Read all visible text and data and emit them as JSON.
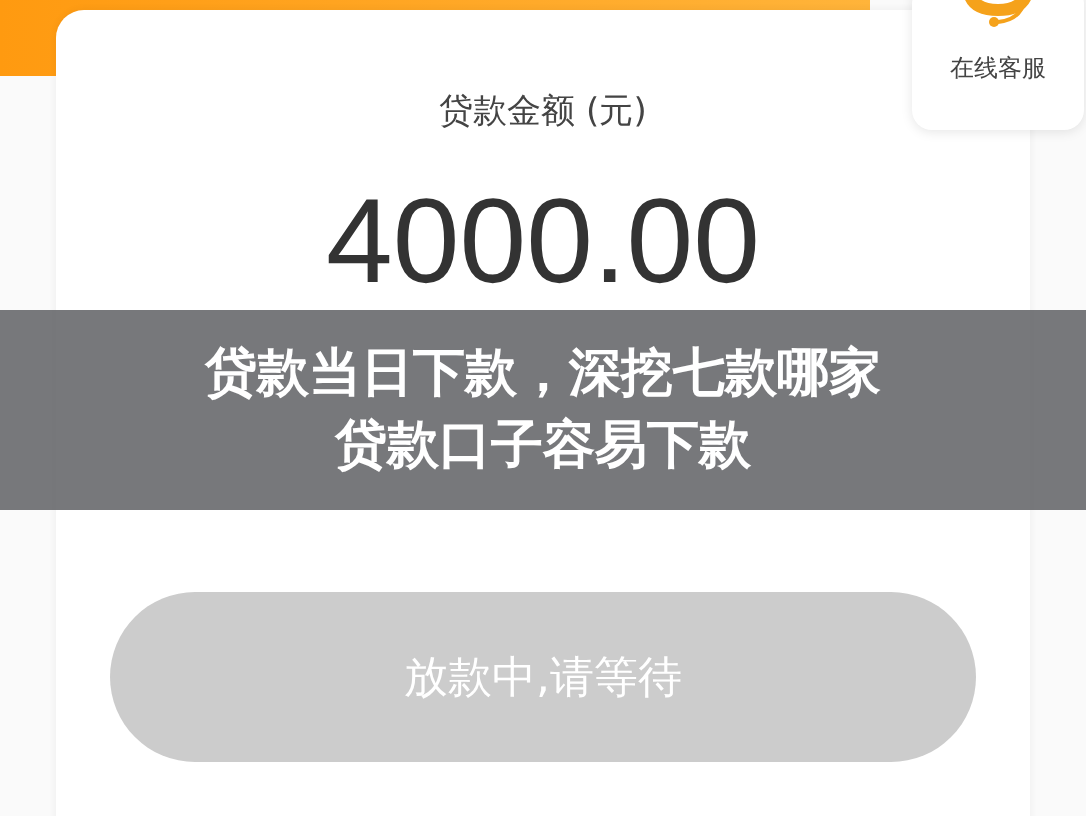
{
  "customer_service": {
    "label": "在线客服"
  },
  "loan": {
    "label": "贷款金额 (元)",
    "amount": "4000.00"
  },
  "status_button": {
    "label": "放款中,请等待",
    "disabled": true
  },
  "overlay_title": {
    "lines": [
      "贷款当日下款，深挖七款哪家",
      "贷款口子容易下款"
    ]
  }
}
